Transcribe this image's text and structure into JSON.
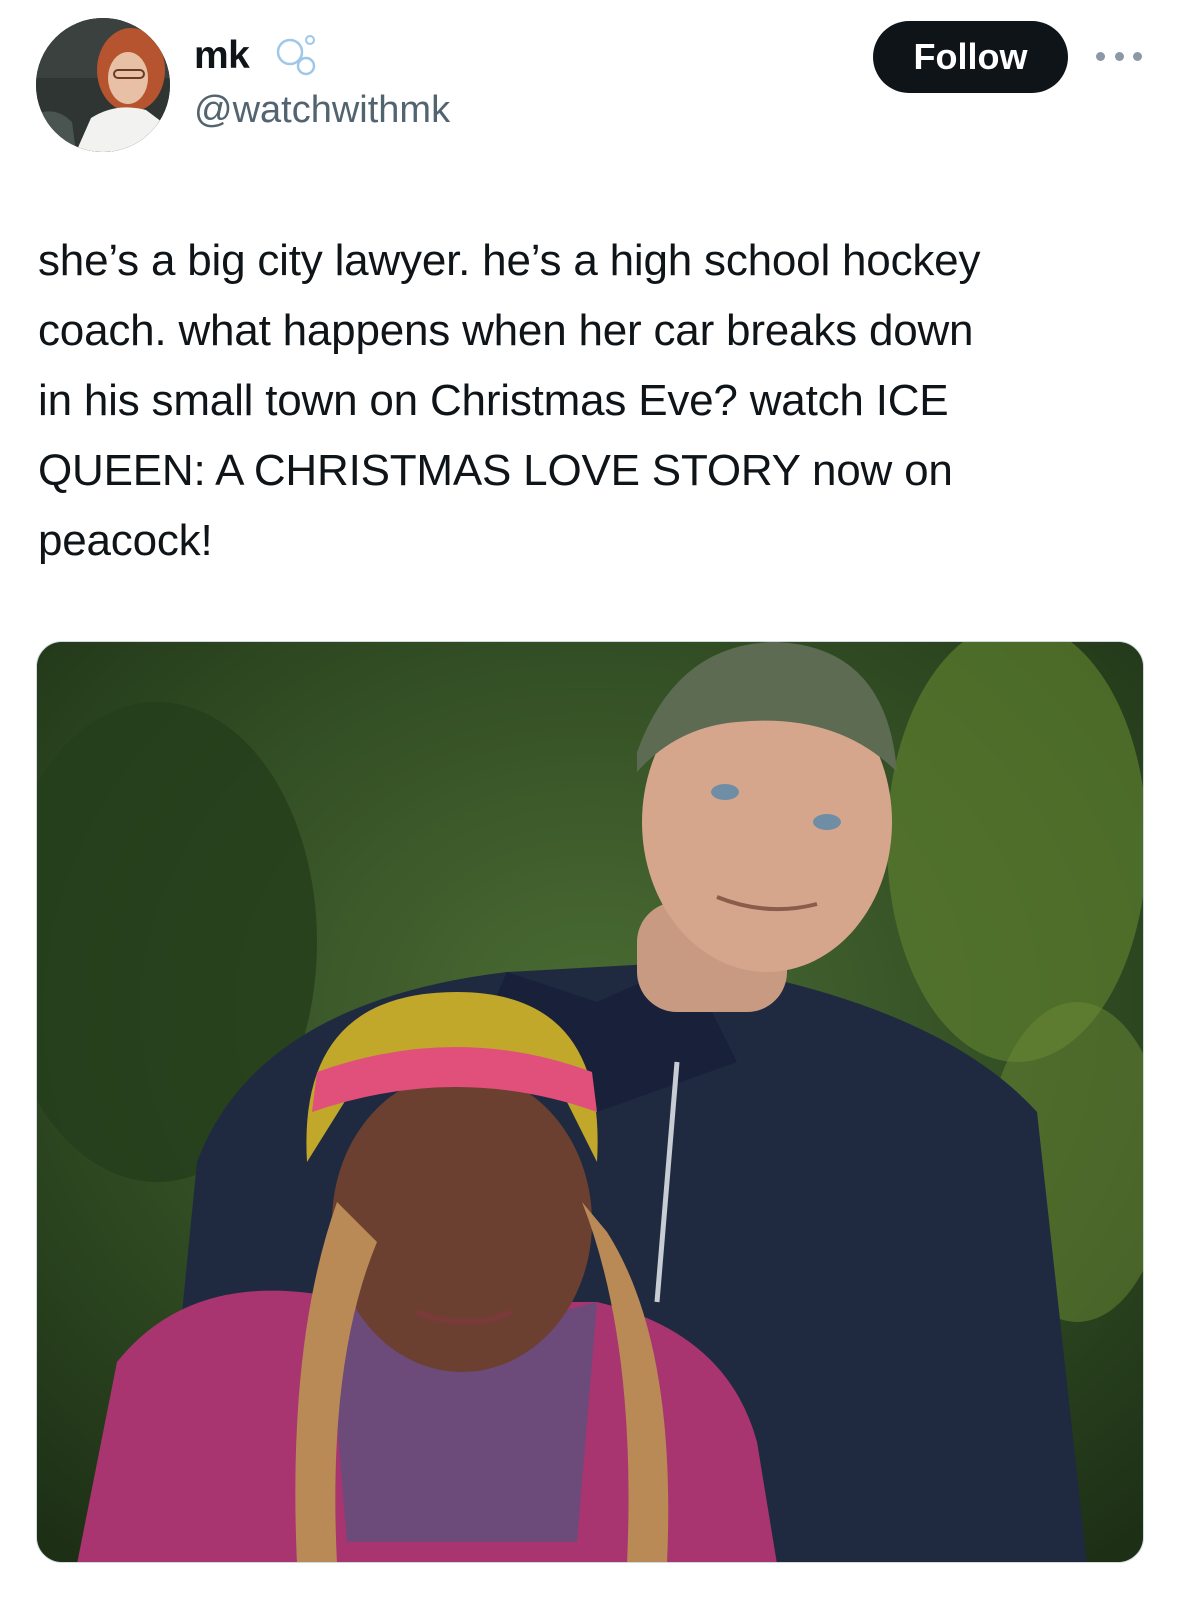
{
  "author": {
    "display_name": "mk",
    "handle": "@watchwithmk",
    "badge_icon": "bubbles-icon",
    "avatar_description_icon": "profile-photo"
  },
  "actions": {
    "follow_label": "Follow",
    "more_icon": "more-options-icon"
  },
  "tweet": {
    "text": "she’s a big city lawyer. he’s a high school hockey\ncoach. what happens when her car breaks down\nin his small town on Christmas Eve? watch ICE\nQUEEN: A CHRISTMAS LOVE STORY now on\npeacock!"
  },
  "colors": {
    "text": "#0f1419",
    "secondary_text": "#536471",
    "follow_bg": "#0f1419",
    "follow_text": "#ffffff"
  }
}
